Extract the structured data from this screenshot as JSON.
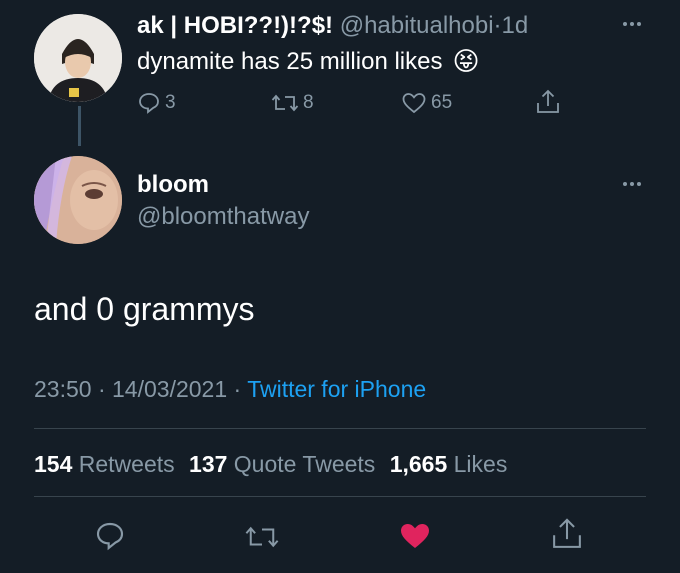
{
  "parent_tweet": {
    "display_name": "ak | HOBI??!)!?$!",
    "handle": "@habitualhobi",
    "separator": "·",
    "time": "1d",
    "text": "dynamite has 25 million likes",
    "emoji": "😝",
    "replies": "3",
    "retweets": "8",
    "likes": "65"
  },
  "main_tweet": {
    "display_name": "bloom",
    "handle": "@bloomthatway",
    "text": "and 0 grammys",
    "time": "23:50",
    "date": "14/03/2021",
    "separator": "·",
    "source": "Twitter for iPhone",
    "retweets_count": "154",
    "retweets_label": "Retweets",
    "quotes_count": "137",
    "quotes_label": "Quote Tweets",
    "likes_count": "1,665",
    "likes_label": "Likes"
  },
  "colors": {
    "background": "#141d26",
    "muted": "#8899a6",
    "link": "#1da1f2",
    "like": "#e0245e",
    "divider": "#38444d"
  }
}
